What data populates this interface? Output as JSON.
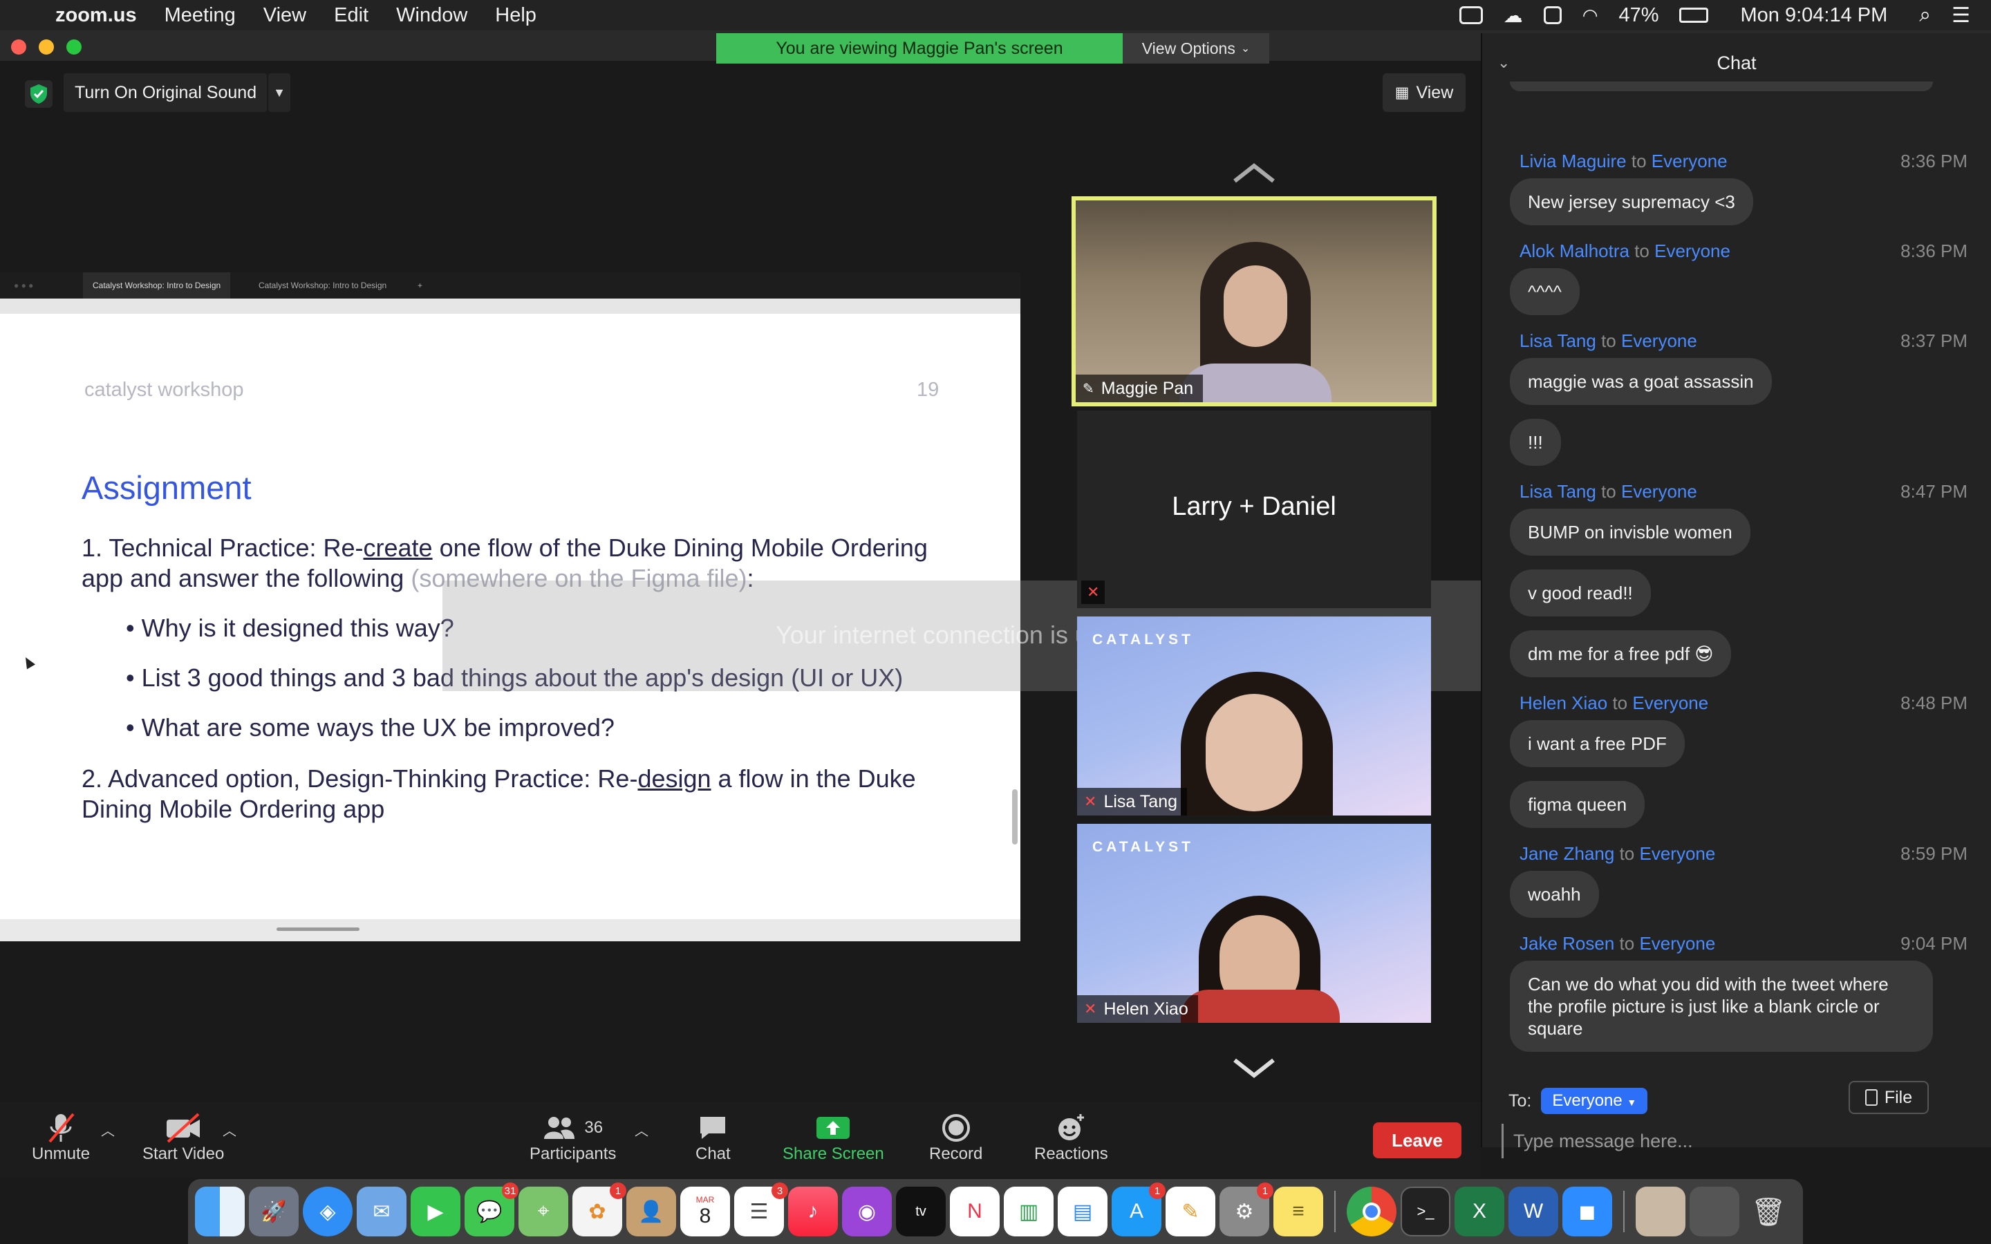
{
  "menubar": {
    "app_name": "zoom.us",
    "menus": [
      "Meeting",
      "View",
      "Edit",
      "Window",
      "Help"
    ],
    "battery": "47%",
    "clock": "Mon 9:04:14 PM"
  },
  "window": {
    "banner": "You are viewing Maggie Pan's screen",
    "view_options": "View Options",
    "original_sound": "Turn On Original Sound",
    "view_button": "View",
    "network_warning": "Your internet connection is unstable"
  },
  "shared_screen": {
    "tab1": "Catalyst Workshop: Intro to Design",
    "tab2": "Catalyst Workshop: Intro to Design",
    "header_left": "catalyst workshop",
    "page_number": "19",
    "title": "Assignment",
    "item1_prefix": "1. Technical Practice: Re-",
    "item1_link": "create",
    "item1_rest": " one flow of the Duke Dining Mobile Ordering",
    "item1_line2": "app and answer the following ",
    "item1_note": "(somewhere on the Figma file)",
    "item1_colon": ":",
    "bullets": [
      "Why is it designed this way?",
      "List 3 good things and 3 bad things about the app's design (UI or UX)",
      "What are some ways the UX be improved?"
    ],
    "item2_prefix": "2. Advanced option, Design-Thinking Practice: Re-",
    "item2_link": "design",
    "item2_rest": " a flow in the Duke",
    "item2_line2": "Dining Mobile Ordering app"
  },
  "videos": {
    "active_speaker": "Maggie Pan",
    "tile2_name": "Larry + Daniel",
    "tile3_name": "Lisa Tang",
    "tile4_name": "Helen Xiao",
    "logo_text": "CATALYST"
  },
  "chat": {
    "title": "Chat",
    "messages": [
      {
        "sender": "Livia Maguire",
        "to": "to",
        "recipient": "Everyone",
        "time": "8:36 PM",
        "bubbles": [
          "New jersey supremacy <3"
        ]
      },
      {
        "sender": "Alok Malhotra",
        "to": "to",
        "recipient": "Everyone",
        "time": "8:36 PM",
        "bubbles": [
          "^^^^"
        ]
      },
      {
        "sender": "Lisa Tang",
        "to": "to",
        "recipient": "Everyone",
        "time": "8:37 PM",
        "bubbles": [
          "maggie was a goat assassin",
          "!!!"
        ]
      },
      {
        "sender": "Lisa Tang",
        "to": "to",
        "recipient": "Everyone",
        "time": "8:47 PM",
        "bubbles": [
          "BUMP on invisble women",
          "v good read!!",
          "dm me for a free pdf 😎"
        ]
      },
      {
        "sender": "Helen Xiao",
        "to": "to",
        "recipient": "Everyone",
        "time": "8:48 PM",
        "bubbles": [
          "i want a free PDF",
          "figma queen"
        ]
      },
      {
        "sender": "Jane Zhang",
        "to": "to",
        "recipient": "Everyone",
        "time": "8:59 PM",
        "bubbles": [
          "woahh"
        ]
      },
      {
        "sender": "Jake Rosen",
        "to": "to",
        "recipient": "Everyone",
        "time": "9:04 PM",
        "bubbles": [
          "Can we do what you did with the tweet where the profile picture is just like a blank circle or square"
        ]
      }
    ],
    "to_label": "To:",
    "to_value": "Everyone",
    "file_label": "File",
    "input_placeholder": "Type message here..."
  },
  "toolbar": {
    "unmute": "Unmute",
    "start_video": "Start Video",
    "participants": "Participants",
    "participant_count": "36",
    "chat": "Chat",
    "share_screen": "Share Screen",
    "record": "Record",
    "reactions": "Reactions",
    "leave": "Leave"
  },
  "dock": {
    "badges": {
      "messages": "31",
      "photos": "1",
      "reminders": "3",
      "appstore": "1",
      "settings": "1"
    },
    "calendar_month": "MAR",
    "calendar_day": "8"
  },
  "colors": {
    "zoom_green": "#3fbd59",
    "chat_blue": "#4a8cff",
    "leave_red": "#d9302e",
    "active_border": "#e6ee7a"
  }
}
